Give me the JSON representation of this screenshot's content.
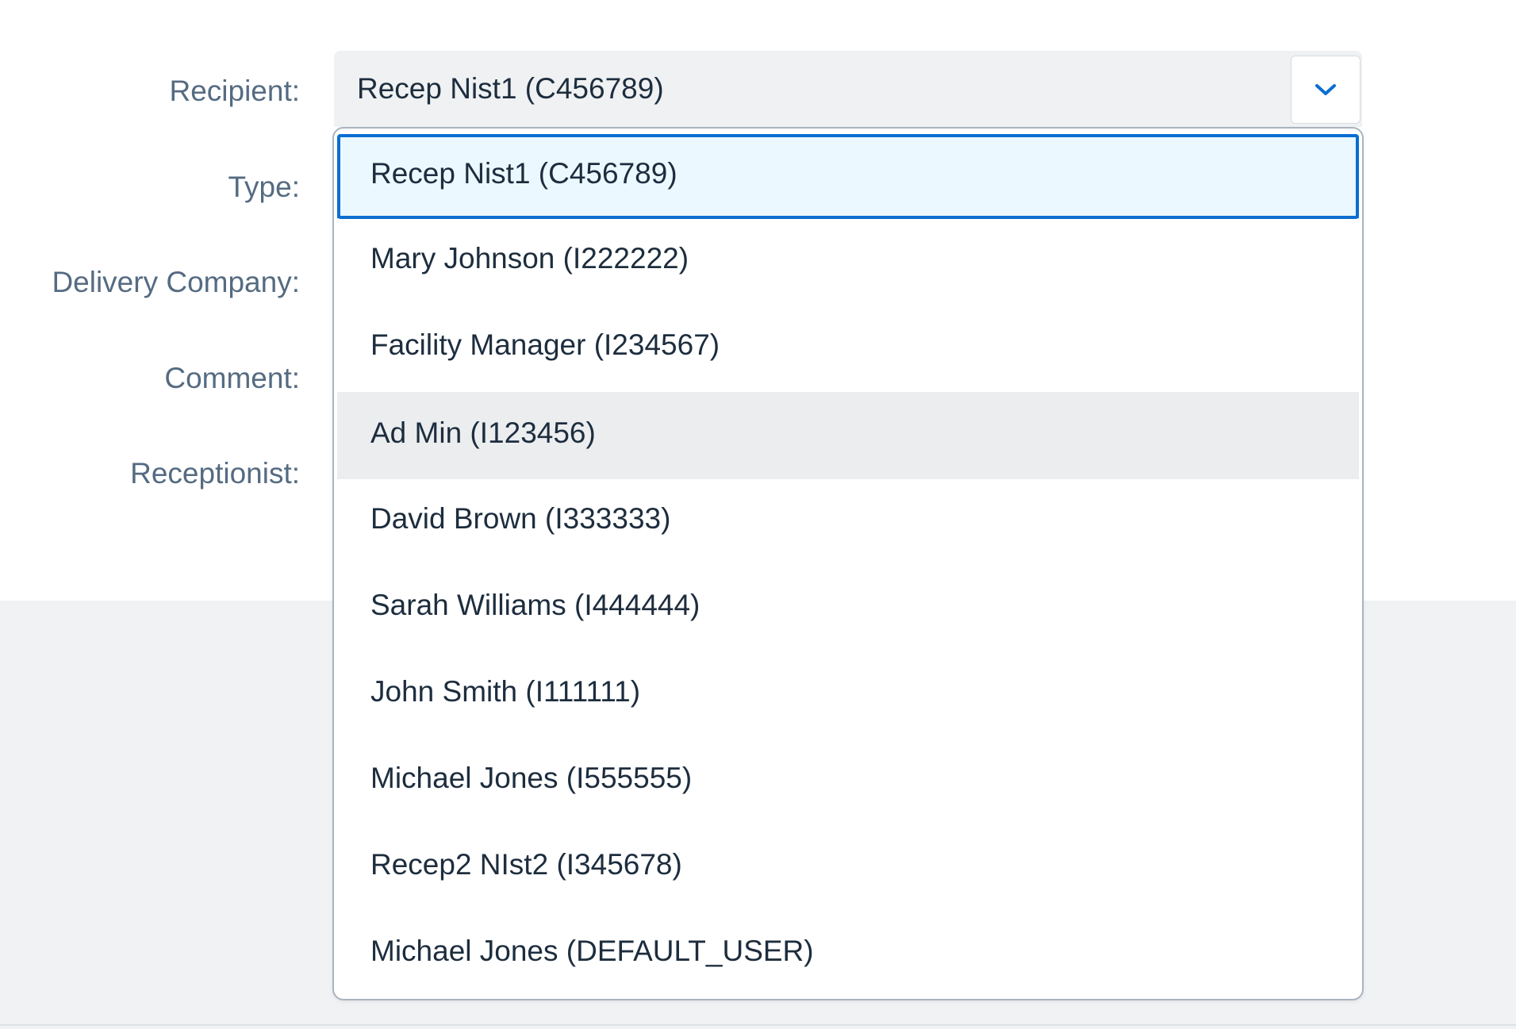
{
  "form": {
    "labels": {
      "recipient": "Recipient:",
      "type": "Type:",
      "delivery_company": "Delivery Company:",
      "comment": "Comment:",
      "receptionist": "Receptionist:"
    },
    "recipient_combo": {
      "value": "Recep Nist1 (C456789)",
      "arrow_icon": "chevron-down-icon"
    }
  },
  "dropdown": {
    "selected_index": 0,
    "hovered_index": 3,
    "options": [
      "Recep Nist1 (C456789)",
      "Mary Johnson (I222222)",
      "Facility Manager (I234567)",
      "Ad Min (I123456)",
      "David Brown (I333333)",
      "Sarah Williams (I444444)",
      "John Smith (I111111)",
      "Michael Jones (I555555)",
      "Recep2 NIst2 (I345678)",
      "Michael Jones (DEFAULT_USER)"
    ]
  },
  "colors": {
    "accent": "#0a6ed1",
    "selected_bg": "#ebf8ff",
    "hover_bg": "#ebedef",
    "label_text": "#556b82",
    "value_text": "#1d2d3e"
  }
}
